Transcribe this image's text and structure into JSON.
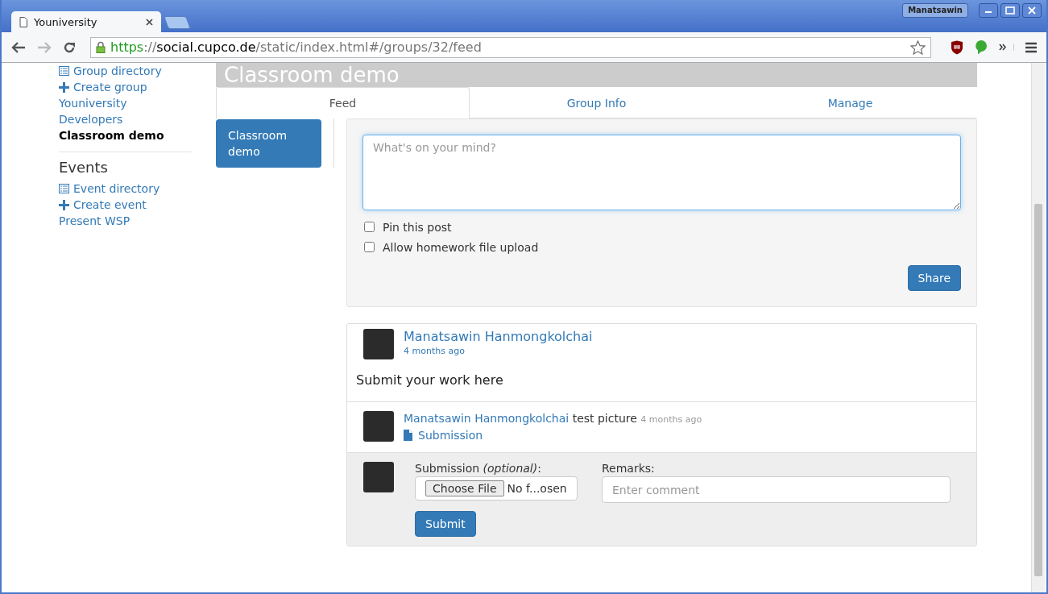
{
  "browser": {
    "tabs": [
      {
        "title": "Youniversity",
        "selected": true
      }
    ],
    "profile": "Manatsawin",
    "url": {
      "scheme": "https",
      "separator": "://",
      "host": "social.cupco.de",
      "path": "/static/index.html#/groups/32/feed"
    }
  },
  "sidebar": {
    "group_items": [
      {
        "kind": "directory",
        "label": "Group directory"
      },
      {
        "kind": "create",
        "label": "Create group"
      },
      {
        "kind": "group",
        "label": "Youniversity",
        "selected": false
      },
      {
        "kind": "group",
        "label": "Developers",
        "selected": false
      },
      {
        "kind": "group",
        "label": "Classroom demo",
        "selected": true
      }
    ],
    "events_heading": "Events",
    "event_items": [
      {
        "kind": "directory",
        "label": "Event directory"
      },
      {
        "kind": "create",
        "label": "Create event"
      },
      {
        "kind": "group",
        "label": "Present WSP",
        "selected": false
      }
    ]
  },
  "group": {
    "title": "Classroom demo",
    "tabs": [
      {
        "label": "Feed",
        "selected": true
      },
      {
        "label": "Group Info",
        "selected": false
      },
      {
        "label": "Manage",
        "selected": false
      }
    ],
    "side_nav": [
      {
        "label": "Classroom demo",
        "selected": true
      }
    ]
  },
  "composer": {
    "placeholder": "What's on your mind?",
    "options": [
      {
        "label": "Pin this post",
        "checked": false
      },
      {
        "label": "Allow homework file upload",
        "checked": false
      }
    ],
    "share_button": "Share"
  },
  "post": {
    "author": "Manatsawin Hanmongkolchai",
    "time": "4 months ago",
    "body": "Submit your work here",
    "comments": [
      {
        "author": "Manatsawin Hanmongkolchai",
        "text": "test picture",
        "time": "4 months ago",
        "attachment": "Submission"
      }
    ],
    "reply_form": {
      "submission_label": "Submission *(optional)*:",
      "choose_file": "Choose File",
      "file_status": "No f...osen",
      "remarks_label": "Remarks:",
      "remarks_placeholder": "Enter comment",
      "submit_button": "Submit"
    }
  }
}
